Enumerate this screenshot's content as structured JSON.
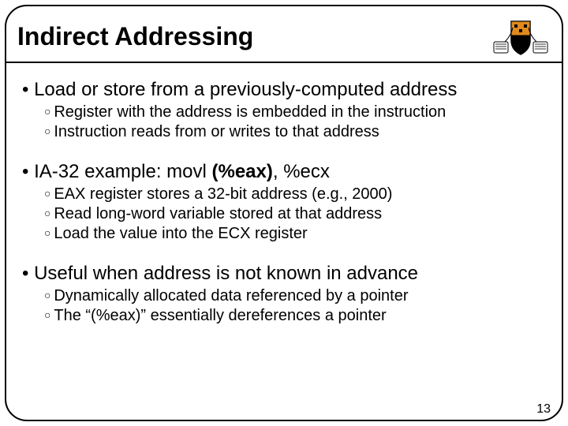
{
  "title": "Indirect Addressing",
  "bullets": {
    "b1": "Load or store from a previously-computed address",
    "b1a": "Register with the address is embedded in the instruction",
    "b1b": "Instruction reads from or writes to that address",
    "b2_pre": "IA-32 example: movl ",
    "b2_bold": "(%eax)",
    "b2_post": ", %ecx",
    "b2a": "EAX register stores a 32-bit address (e.g., 2000)",
    "b2b": "Read long-word variable stored at that address",
    "b2c": "Load the value into the ECX register",
    "b3": "Useful when address is not known in advance",
    "b3a": "Dynamically allocated data referenced by a pointer",
    "b3b": "The “(%eax)” essentially dereferences a pointer"
  },
  "page_number": "13"
}
